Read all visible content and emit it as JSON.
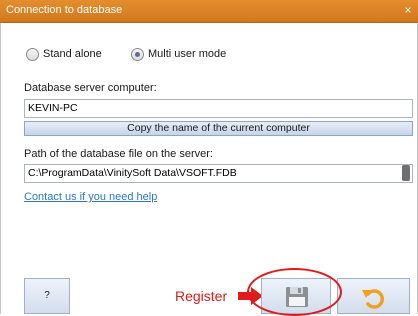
{
  "window": {
    "title": "Connection to database",
    "close_glyph": "×"
  },
  "mode": {
    "options": [
      {
        "label": "Stand alone",
        "selected": false
      },
      {
        "label": "Multi user mode",
        "selected": true
      }
    ]
  },
  "server": {
    "label": "Database server computer:",
    "value": "KEVIN-PC",
    "copy_button_label": "Copy the name of the current computer"
  },
  "path": {
    "label": "Path of the database file on the server:",
    "value": "C:\\ProgramData\\VinitySoft Data\\VSOFT.FDB"
  },
  "help_link": "Contact us if you need help",
  "footer": {
    "help_button_label": "?",
    "save_icon": "floppy-disk-icon",
    "undo_icon": "undo-arrow-icon"
  },
  "annotation": {
    "label": "Register",
    "color": "#e01b1b"
  },
  "colors": {
    "titlebar": "#d9801f",
    "link": "#2f78c6",
    "undo_icon": "#f0a020"
  }
}
